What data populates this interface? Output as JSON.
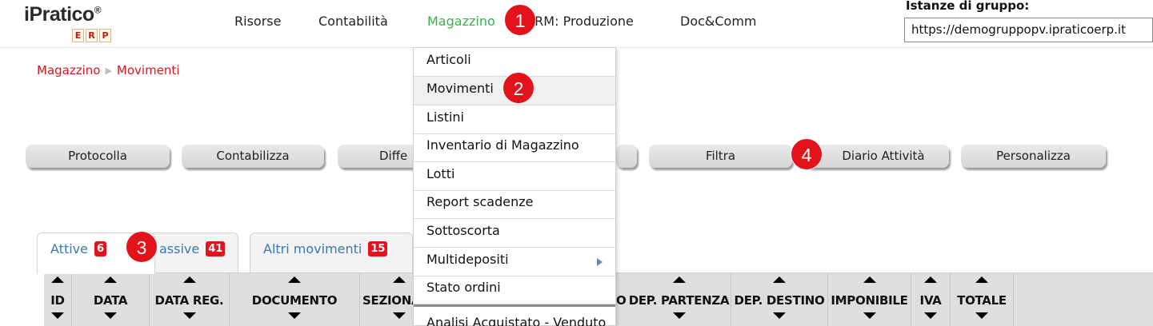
{
  "header": {
    "logo_text": "iPratico",
    "logo_tm": "®",
    "logo_erp": [
      "E",
      "R",
      "P"
    ],
    "nav": [
      "Risorse",
      "Contabilità",
      "Magazzino",
      "CRM: Produzione",
      "Doc&Comm"
    ],
    "active_nav": "Magazzino",
    "group_label": "Istanze di gruppo:",
    "group_value": "https://demogruppopv.ipraticoerp.it"
  },
  "breadcrumb": [
    "Magazzino",
    "Movimenti"
  ],
  "toolbar": [
    "Protocolla",
    "Contabilizza",
    "Diffe",
    "Filtra",
    "Diario Attività",
    "Personalizza"
  ],
  "tabs": [
    {
      "label": "Attive",
      "count": "6"
    },
    {
      "label": "assive",
      "count": "41"
    },
    {
      "label": "Altri movimenti",
      "count": "15"
    }
  ],
  "table_headers": [
    "ID",
    "DATA",
    "DATA REG.",
    "DOCUMENTO",
    "SEZIONA",
    "O",
    "DEP. PARTENZA",
    "DEP. DESTINO",
    "IMPONIBILE",
    "IVA",
    "TOTALE"
  ],
  "dropdown": {
    "items": [
      "Articoli",
      "Movimenti",
      "Listini",
      "Inventario di Magazzino",
      "Lotti",
      "Report scadenze",
      "Sottoscorta",
      "Multidepositi",
      "Stato ordini",
      "Analisi Acquistato - Venduto"
    ],
    "hovered": "Movimenti",
    "submenu_item": "Multidepositi"
  },
  "markers": [
    "1",
    "2",
    "3",
    "4"
  ],
  "colors": {
    "accent_green": "#36b34b",
    "accent_red": "#e3131b",
    "breadcrumb_red": "#d9171d",
    "tab_blue": "#3a77b5"
  }
}
